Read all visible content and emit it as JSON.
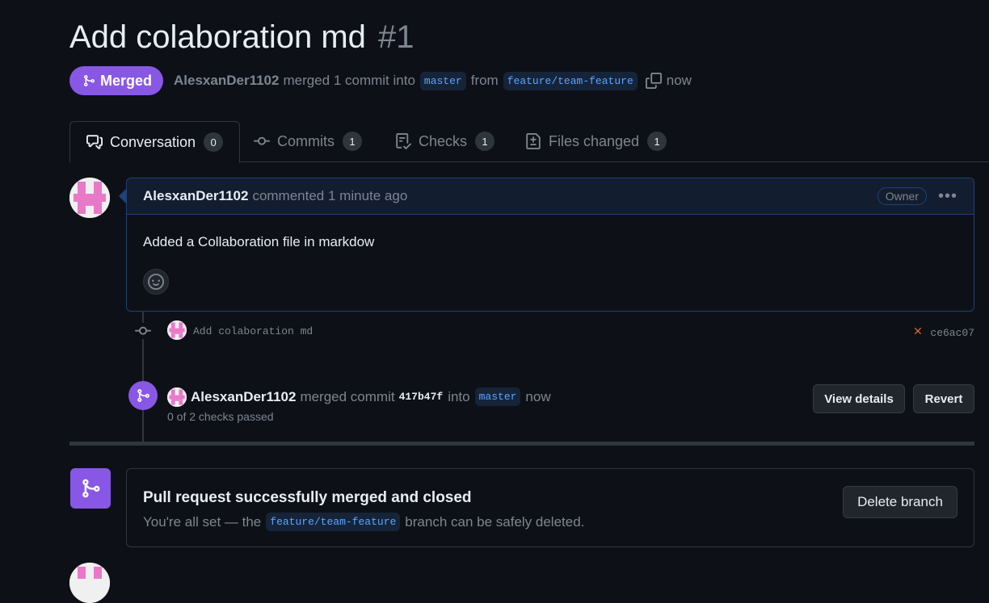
{
  "pr": {
    "title": "Add colaboration md",
    "number": "#1",
    "state": "Merged",
    "author": "AlesxanDer1102",
    "action": "merged 1 commit into",
    "base_branch": "master",
    "from_word": "from",
    "head_branch": "feature/team-feature",
    "time": "now"
  },
  "tabs": [
    {
      "label": "Conversation",
      "count": "0",
      "icon": "comment-discussion-icon"
    },
    {
      "label": "Commits",
      "count": "1",
      "icon": "git-commit-icon"
    },
    {
      "label": "Checks",
      "count": "1",
      "icon": "checklist-icon"
    },
    {
      "label": "Files changed",
      "count": "1",
      "icon": "file-diff-icon"
    }
  ],
  "comment": {
    "author": "AlesxanDer1102",
    "action": "commented",
    "time": "1 minute ago",
    "badge": "Owner",
    "body": "Added a Collaboration file in markdow"
  },
  "commit": {
    "message": "Add colaboration md",
    "sha": "ce6ac07",
    "status_icon": "x-icon"
  },
  "merge_event": {
    "author": "AlesxanDer1102",
    "action": "merged commit",
    "sha": "417b47f",
    "into_word": "into",
    "branch": "master",
    "time": "now",
    "checks": "0 of 2 checks passed",
    "view_details_label": "View details",
    "revert_label": "Revert"
  },
  "merged_box": {
    "title": "Pull request successfully merged and closed",
    "sub_pre": "You're all set — the",
    "branch": "feature/team-feature",
    "sub_post": "branch can be safely deleted.",
    "delete_label": "Delete branch"
  },
  "colors": {
    "merged": "#8957e5",
    "bg": "#0d1117",
    "accent": "#58a6ff"
  }
}
